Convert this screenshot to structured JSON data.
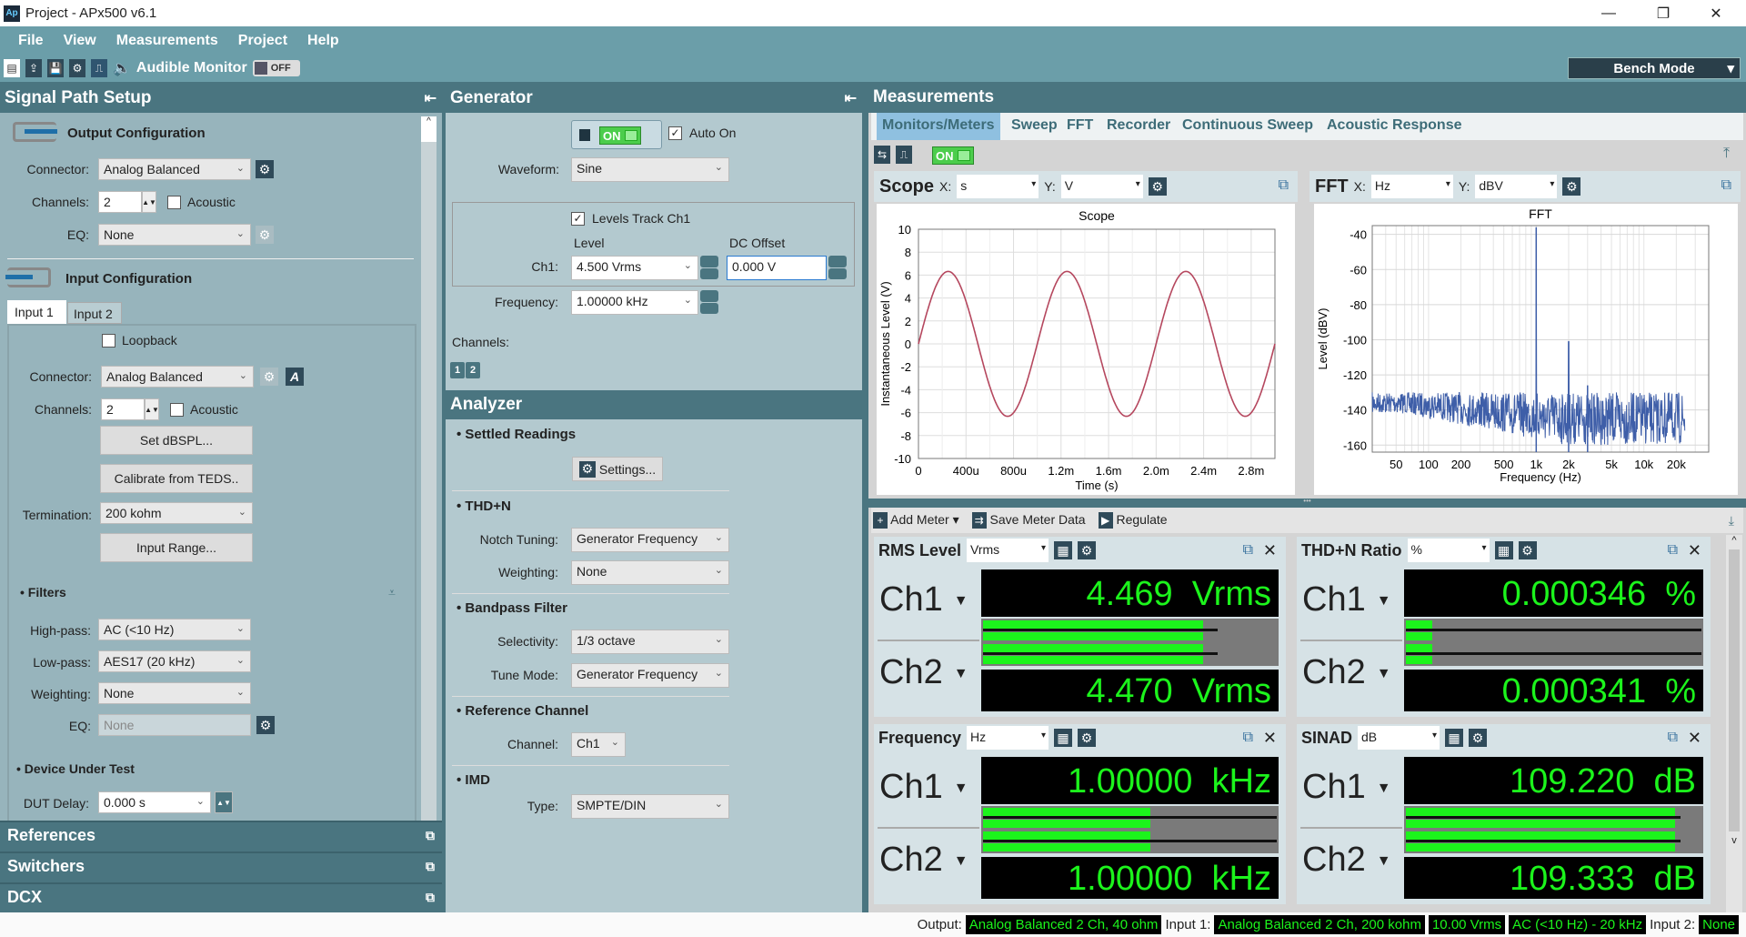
{
  "window": {
    "title": "Project - APx500 v6.1",
    "minimize": "—",
    "restore": "❐",
    "close": "✕"
  },
  "menu": [
    "File",
    "View",
    "Measurements",
    "Project",
    "Help"
  ],
  "toolbar": {
    "audible_monitor": "Audible Monitor",
    "audible_state": "OFF",
    "bench_mode": "Bench Mode"
  },
  "signal_path": {
    "title": "Signal Path Setup",
    "output": {
      "heading": "Output Configuration",
      "connector_label": "Connector:",
      "connector": "Analog Balanced",
      "channels_label": "Channels:",
      "channels": "2",
      "acoustic": "Acoustic",
      "eq_label": "EQ:",
      "eq": "None"
    },
    "input": {
      "heading": "Input Configuration",
      "tabs": [
        "Input 1",
        "Input 2"
      ],
      "loopback": "Loopback",
      "connector_label": "Connector:",
      "connector": "Analog Balanced",
      "channels_label": "Channels:",
      "channels": "2",
      "acoustic": "Acoustic",
      "set_dbspl": "Set dBSPL...",
      "calibrate_teds": "Calibrate from TEDS..",
      "termination_label": "Termination:",
      "termination": "200 kohm",
      "input_range": "Input Range..."
    },
    "filters": {
      "heading": "Filters",
      "highpass_label": "High-pass:",
      "highpass": "AC (<10 Hz)",
      "lowpass_label": "Low-pass:",
      "lowpass": "AES17 (20 kHz)",
      "weighting_label": "Weighting:",
      "weighting": "None",
      "eq_label": "EQ:",
      "eq": "None"
    },
    "dut": {
      "heading": "Device Under Test",
      "delay_label": "DUT Delay:",
      "delay": "0.000 s"
    },
    "collapsed": [
      "References",
      "Switchers",
      "DCX"
    ]
  },
  "generator": {
    "title": "Generator",
    "on": "ON",
    "auto_on": "Auto On",
    "waveform_label": "Waveform:",
    "waveform": "Sine",
    "levels_track": "Levels Track Ch1",
    "level_hdr": "Level",
    "dc_hdr": "DC Offset",
    "ch1_label": "Ch1:",
    "ch1_level": "4.500 Vrms",
    "dc_offset": "0.000 V",
    "freq_label": "Frequency:",
    "frequency": "1.00000 kHz",
    "channels_label": "Channels:",
    "ch_buttons": [
      "1",
      "2"
    ]
  },
  "analyzer": {
    "title": "Analyzer",
    "settled": "Settled Readings",
    "settings": "Settings...",
    "thdn": "THD+N",
    "notch_label": "Notch Tuning:",
    "notch": "Generator Frequency",
    "weighting_label": "Weighting:",
    "weighting": "None",
    "bandpass": "Bandpass Filter",
    "selectivity_label": "Selectivity:",
    "selectivity": "1/3 octave",
    "tune_label": "Tune Mode:",
    "tune": "Generator Frequency",
    "refch": "Reference Channel",
    "channel_label": "Channel:",
    "channel": "Ch1",
    "imd": "IMD",
    "type_label": "Type:",
    "type": "SMPTE/DIN"
  },
  "measurements": {
    "title": "Measurements",
    "tabs": [
      "Monitors/Meters",
      "Sweep",
      "FFT",
      "Recorder",
      "Continuous Sweep",
      "Acoustic Response"
    ],
    "on": "ON",
    "scope": {
      "name": "Scope",
      "x_label": "X:",
      "x_unit": "s",
      "y_label": "Y:",
      "y_unit": "V"
    },
    "fft": {
      "name": "FFT",
      "x_label": "X:",
      "x_unit": "Hz",
      "y_label": "Y:",
      "y_unit": "dBV"
    },
    "meter_toolbar": {
      "add": "Add Meter",
      "save": "Save Meter Data",
      "regulate": "Regulate"
    },
    "meters": [
      {
        "name": "RMS Level",
        "unit": "Vrms",
        "ch": [
          {
            "label": "Ch1",
            "value": "4.469",
            "unit": "Vrms",
            "fill": 0.75,
            "peak": 0.8
          },
          {
            "label": "Ch2",
            "value": "4.470",
            "unit": "Vrms",
            "fill": 0.75,
            "peak": 0.8
          }
        ]
      },
      {
        "name": "THD+N Ratio",
        "unit": "%",
        "ch": [
          {
            "label": "Ch1",
            "value": "0.000346",
            "unit": "%",
            "fill": 0.09,
            "peak": 1.0
          },
          {
            "label": "Ch2",
            "value": "0.000341",
            "unit": "%",
            "fill": 0.09,
            "peak": 1.0
          }
        ]
      },
      {
        "name": "Frequency",
        "unit": "Hz",
        "ch": [
          {
            "label": "Ch1",
            "value": "1.00000",
            "unit": "kHz",
            "fill": 0.57,
            "peak": 1.0
          },
          {
            "label": "Ch2",
            "value": "1.00000",
            "unit": "kHz",
            "fill": 0.57,
            "peak": 1.0
          }
        ]
      },
      {
        "name": "SINAD",
        "unit": "dB",
        "ch": [
          {
            "label": "Ch1",
            "value": "109.220",
            "unit": "dB",
            "fill": 0.91,
            "peak": 0.93
          },
          {
            "label": "Ch2",
            "value": "109.333",
            "unit": "dB",
            "fill": 0.91,
            "peak": 0.93
          }
        ]
      }
    ]
  },
  "status": {
    "output_label": "Output:",
    "output": "Analog Balanced 2 Ch, 40 ohm",
    "input1_label": "Input 1:",
    "input1": "Analog Balanced 2 Ch, 200 kohm",
    "range": "10.00 Vrms",
    "bw": "AC (<10 Hz) - 20 kHz",
    "input2_label": "Input 2:",
    "input2": "None"
  },
  "colors": {
    "panel_header": "#4a7580",
    "meter_green": "#1cf41c",
    "scope_trace": "#b5475e",
    "fft_trace": "#3e5ea8"
  },
  "chart_data": [
    {
      "type": "line",
      "title": "Scope",
      "xlabel": "Time (s)",
      "ylabel": "Instantaneous Level (V)",
      "xlim": [
        0,
        0.003
      ],
      "ylim": [
        -10,
        10
      ],
      "grid": true,
      "x_ticks": [
        "0",
        "400u",
        "800u",
        "1.2m",
        "1.6m",
        "2.0m",
        "2.4m",
        "2.8m"
      ],
      "y_ticks": [
        "10",
        "8",
        "6",
        "4",
        "2",
        "0",
        "-2",
        "-4",
        "-6",
        "-8",
        "-10"
      ],
      "signal": {
        "waveform": "sine",
        "frequency_hz": 1000,
        "peak_v": 6.32
      }
    },
    {
      "type": "line",
      "title": "FFT",
      "xlabel": "Frequency (Hz)",
      "ylabel": "Level (dBV)",
      "xscale": "log",
      "xlim": [
        30,
        40000
      ],
      "ylim": [
        -164,
        -35
      ],
      "grid": true,
      "x_ticks": [
        "50",
        "100",
        "200",
        "500",
        "1k",
        "2k",
        "5k",
        "10k",
        "20k"
      ],
      "y_ticks": [
        "-40",
        "-60",
        "-80",
        "-100",
        "-120",
        "-140",
        "-160"
      ],
      "peaks": [
        {
          "freq_hz": 1000,
          "level_dbv": -36
        },
        {
          "freq_hz": 2000,
          "level_dbv": -101
        },
        {
          "freq_hz": 3000,
          "level_dbv": -126
        }
      ],
      "noise_floor_dbv": [
        -160,
        -125
      ],
      "noise_end_hz": 24000
    }
  ]
}
